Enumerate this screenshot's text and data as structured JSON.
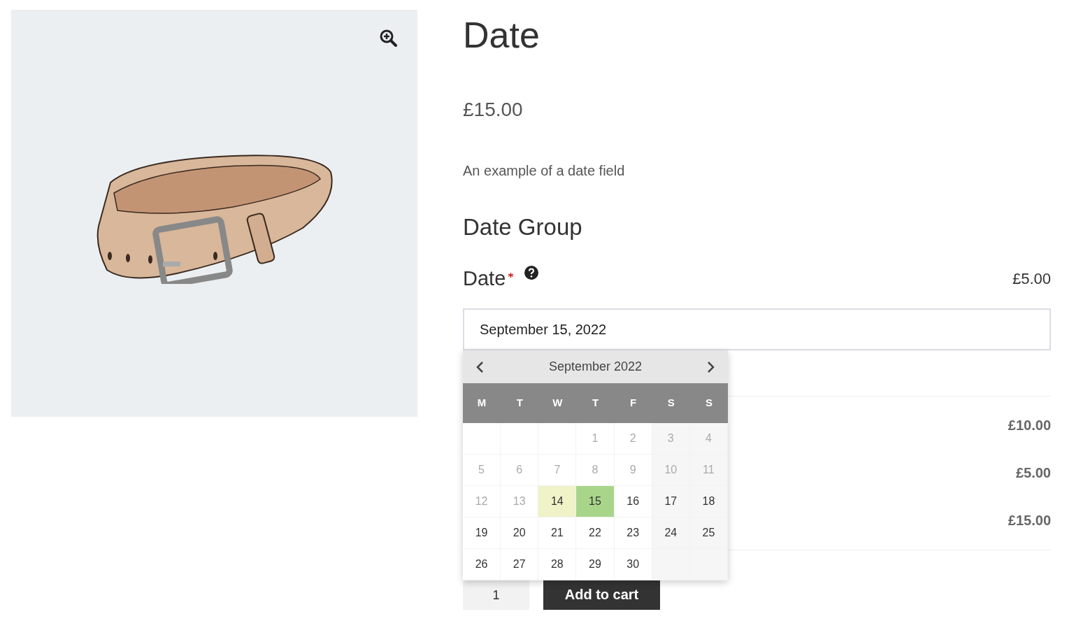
{
  "product": {
    "title": "Date",
    "price": "£15.00",
    "description": "An example of a date field"
  },
  "group": {
    "title": "Date Group"
  },
  "field": {
    "label": "Date",
    "required": true,
    "price": "£5.00",
    "value": "September 15, 2022"
  },
  "calendar": {
    "month": "September 2022",
    "weekdays": [
      "M",
      "T",
      "W",
      "T",
      "F",
      "S",
      "S"
    ],
    "weeks": [
      [
        {
          "kind": "blank"
        },
        {
          "kind": "blank"
        },
        {
          "kind": "blank"
        },
        {
          "kind": "day",
          "day": "1",
          "disabled": true,
          "today": false,
          "selected": false
        },
        {
          "kind": "day",
          "day": "2",
          "disabled": true,
          "today": false,
          "selected": false
        },
        {
          "kind": "day",
          "day": "3",
          "disabled": true,
          "today": false,
          "selected": false
        },
        {
          "kind": "day",
          "day": "4",
          "disabled": true,
          "today": false,
          "selected": false
        }
      ],
      [
        {
          "kind": "day",
          "day": "5",
          "disabled": true,
          "today": false,
          "selected": false
        },
        {
          "kind": "day",
          "day": "6",
          "disabled": true,
          "today": false,
          "selected": false
        },
        {
          "kind": "day",
          "day": "7",
          "disabled": true,
          "today": false,
          "selected": false
        },
        {
          "kind": "day",
          "day": "8",
          "disabled": true,
          "today": false,
          "selected": false
        },
        {
          "kind": "day",
          "day": "9",
          "disabled": true,
          "today": false,
          "selected": false
        },
        {
          "kind": "day",
          "day": "10",
          "disabled": true,
          "today": false,
          "selected": false
        },
        {
          "kind": "day",
          "day": "11",
          "disabled": true,
          "today": false,
          "selected": false
        }
      ],
      [
        {
          "kind": "day",
          "day": "12",
          "disabled": true,
          "today": false,
          "selected": false
        },
        {
          "kind": "day",
          "day": "13",
          "disabled": true,
          "today": false,
          "selected": false
        },
        {
          "kind": "day",
          "day": "14",
          "disabled": false,
          "today": true,
          "selected": false
        },
        {
          "kind": "day",
          "day": "15",
          "disabled": false,
          "today": false,
          "selected": true
        },
        {
          "kind": "day",
          "day": "16",
          "disabled": false,
          "today": false,
          "selected": false
        },
        {
          "kind": "day",
          "day": "17",
          "disabled": false,
          "today": false,
          "selected": false
        },
        {
          "kind": "day",
          "day": "18",
          "disabled": false,
          "today": false,
          "selected": false
        }
      ],
      [
        {
          "kind": "day",
          "day": "19",
          "disabled": false,
          "today": false,
          "selected": false
        },
        {
          "kind": "day",
          "day": "20",
          "disabled": false,
          "today": false,
          "selected": false
        },
        {
          "kind": "day",
          "day": "21",
          "disabled": false,
          "today": false,
          "selected": false
        },
        {
          "kind": "day",
          "day": "22",
          "disabled": false,
          "today": false,
          "selected": false
        },
        {
          "kind": "day",
          "day": "23",
          "disabled": false,
          "today": false,
          "selected": false
        },
        {
          "kind": "day",
          "day": "24",
          "disabled": false,
          "today": false,
          "selected": false
        },
        {
          "kind": "day",
          "day": "25",
          "disabled": false,
          "today": false,
          "selected": false
        }
      ],
      [
        {
          "kind": "day",
          "day": "26",
          "disabled": false,
          "today": false,
          "selected": false
        },
        {
          "kind": "day",
          "day": "27",
          "disabled": false,
          "today": false,
          "selected": false
        },
        {
          "kind": "day",
          "day": "28",
          "disabled": false,
          "today": false,
          "selected": false
        },
        {
          "kind": "day",
          "day": "29",
          "disabled": false,
          "today": false,
          "selected": false
        },
        {
          "kind": "day",
          "day": "30",
          "disabled": false,
          "today": false,
          "selected": false
        },
        {
          "kind": "blank"
        },
        {
          "kind": "blank"
        }
      ]
    ]
  },
  "totals": [
    {
      "amount": "£10.00"
    },
    {
      "amount": "£5.00"
    },
    {
      "amount": "£15.00"
    }
  ],
  "cart": {
    "quantity": "1",
    "button": "Add to cart"
  }
}
